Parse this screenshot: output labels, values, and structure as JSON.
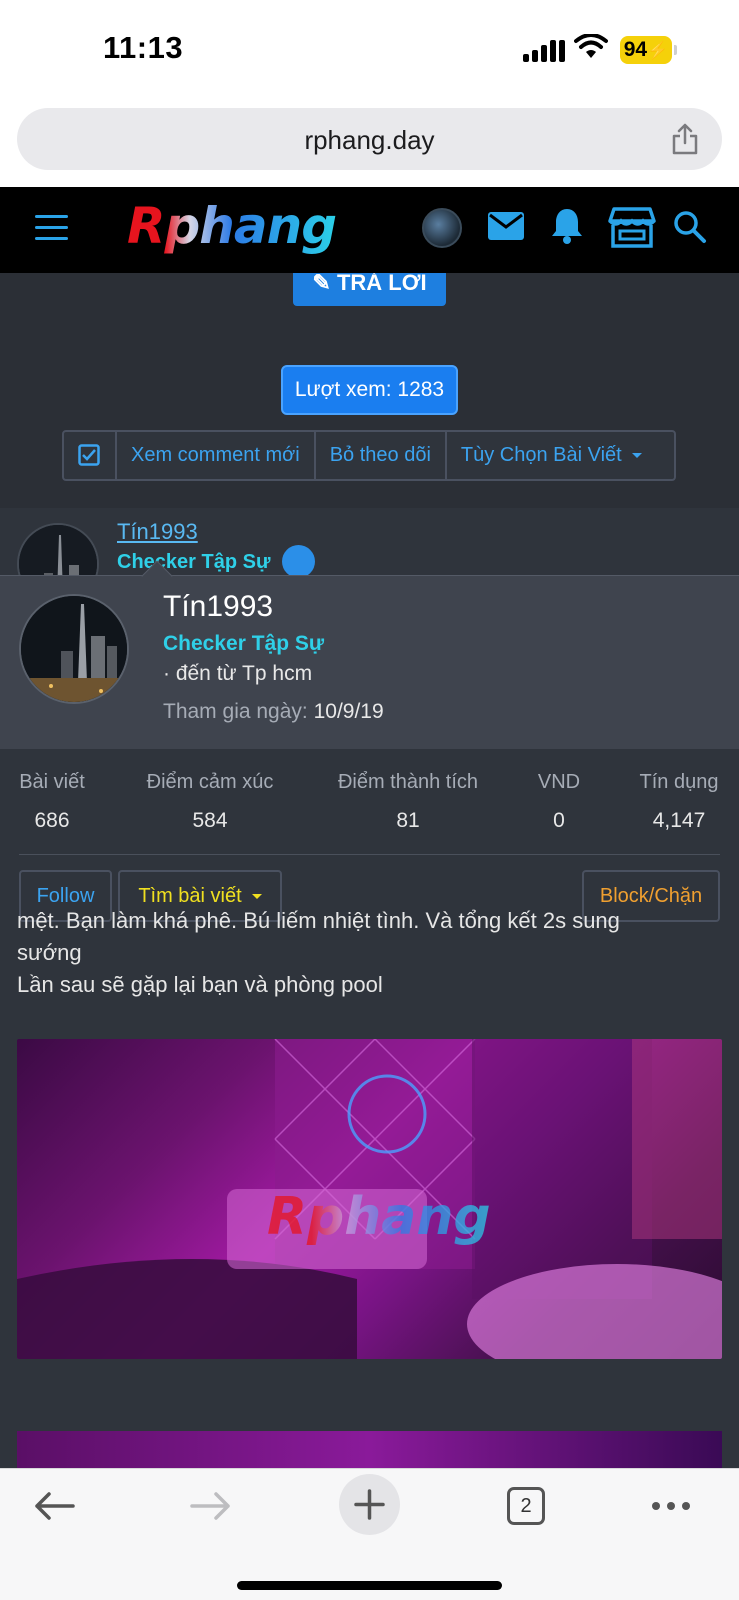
{
  "status": {
    "time": "11:13",
    "battery": "94"
  },
  "browser": {
    "url": "rphang.day",
    "tab_count": "2"
  },
  "header": {
    "logo": "Rphang"
  },
  "thread": {
    "reply_label": "TRẢ LỜI",
    "views_label": "Lượt xem: 1283",
    "actions": {
      "new_comments": "Xem comment mới",
      "unfollow": "Bỏ theo dõi",
      "post_options": "Tùy Chọn Bài Viết"
    }
  },
  "post": {
    "username": "Tín1993",
    "user_title": "Checker Tập Sự",
    "text_line1": "mệt. Bạn làm khá phê. Bú liếm nhiệt tình. Và tổng kết 2s sung",
    "text_line2": "sướng",
    "text_line3": "Lần sau sẽ gặp lại bạn và phòng pool",
    "image_watermark": "Rphang"
  },
  "member_card": {
    "name": "Tín1993",
    "title": "Checker Tập Sự",
    "location": "· đến từ Tp hcm",
    "join_label": "Tham gia ngày:",
    "join_date": "10/9/19",
    "stats": [
      {
        "label": "Bài viết",
        "value": "686"
      },
      {
        "label": "Điểm cảm xúc",
        "value": "584"
      },
      {
        "label": "Điểm thành tích",
        "value": "81"
      },
      {
        "label": "VND",
        "value": "0"
      },
      {
        "label": "Tín dụng",
        "value": "4,147"
      }
    ],
    "follow_label": "Follow",
    "find_posts_label": "Tìm bài viết",
    "block_label": "Block/Chặn"
  },
  "colors": {
    "accent": "#1e7fe0",
    "link": "#3ba3f0",
    "user_title": "#2fd0e8",
    "find_posts": "#f0e020",
    "block": "#f0a030"
  }
}
